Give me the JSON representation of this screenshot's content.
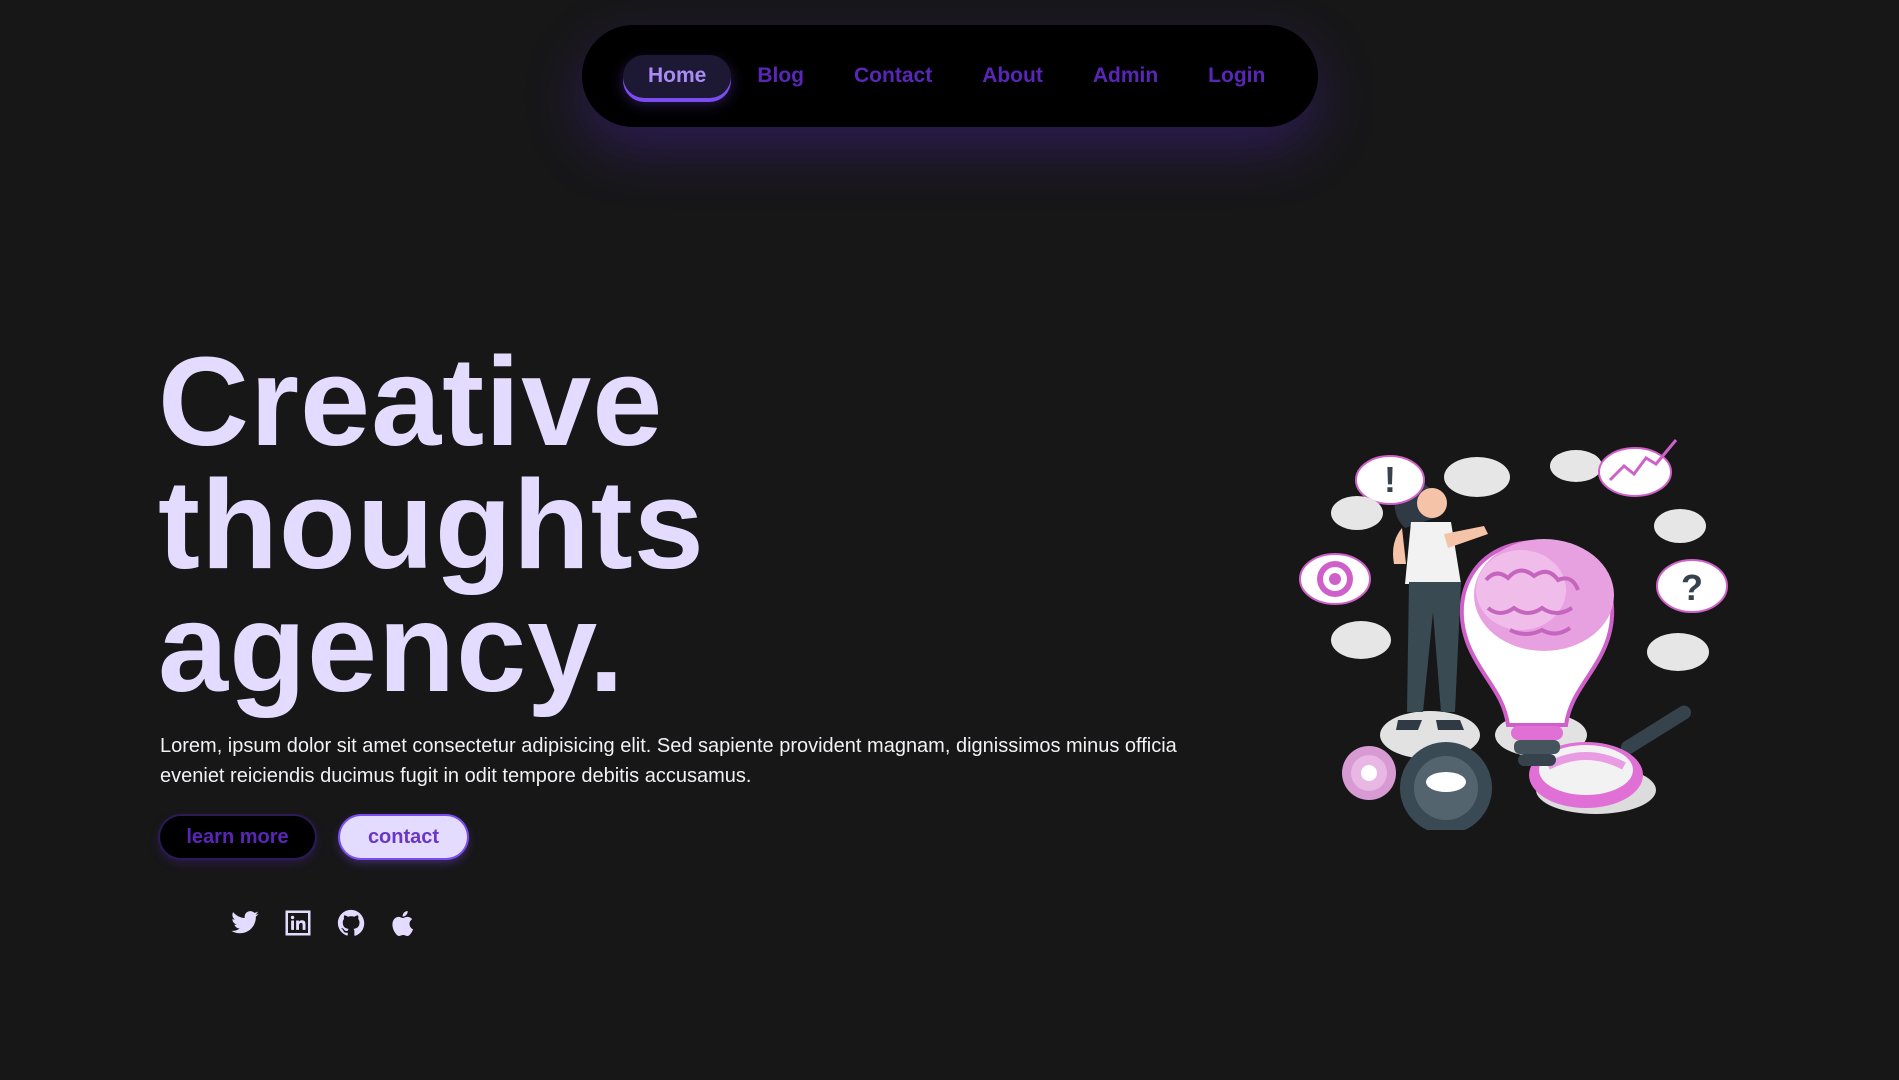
{
  "nav": {
    "items": [
      {
        "label": "Home",
        "active": true
      },
      {
        "label": "Blog",
        "active": false
      },
      {
        "label": "Contact",
        "active": false
      },
      {
        "label": "About",
        "active": false
      },
      {
        "label": "Admin",
        "active": false
      },
      {
        "label": "Login",
        "active": false
      }
    ]
  },
  "hero": {
    "headline": [
      "Creative",
      "thoughts",
      "agency."
    ],
    "description": "Lorem, ipsum dolor sit amet consectetur adipisicing elit. Sed sapiente provident magnam, dignissimos minus officia eveniet reiciendis ducimus fugit in odit tempore debitis accusamus.",
    "learn_more_label": "learn more",
    "contact_label": "contact"
  },
  "socials": [
    {
      "icon": "twitter-icon"
    },
    {
      "icon": "linkedin-icon"
    },
    {
      "icon": "github-icon"
    },
    {
      "icon": "apple-icon"
    }
  ],
  "illustration": {
    "depicts": "woman-with-lightbulb-brain-illustration",
    "bubble_symbols": [
      "!",
      "?"
    ]
  },
  "colors": {
    "background": "#171718",
    "nav_background": "#000000",
    "nav_link": "#5a26b8",
    "accent": "#7b4df0",
    "headline": "#e3dcff",
    "body_text": "#f2f2f5",
    "illustration_pink": "#e98fe0"
  }
}
